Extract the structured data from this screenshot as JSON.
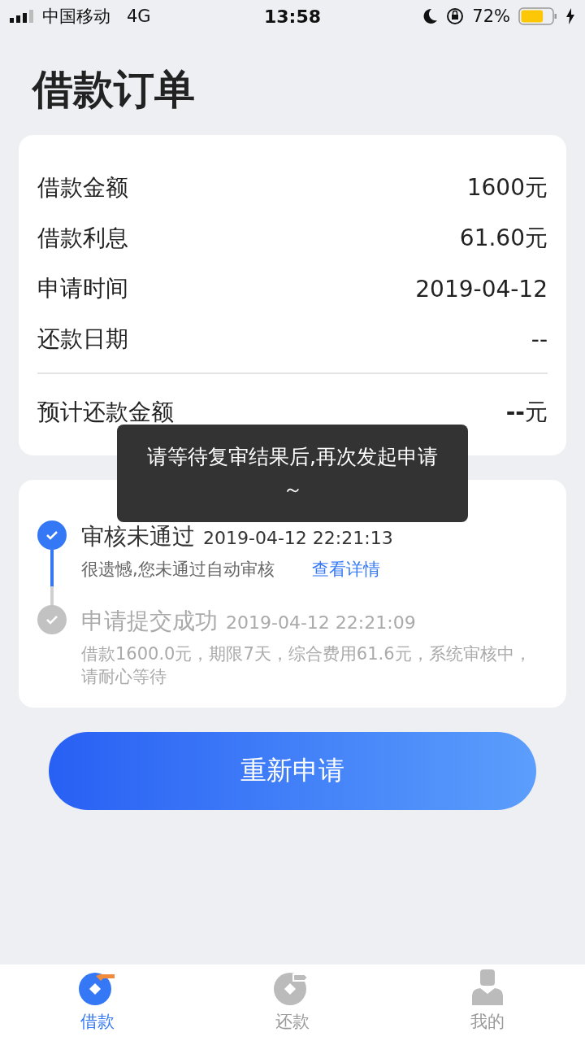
{
  "status_bar": {
    "carrier": "中国移动",
    "network": "4G",
    "time": "13:58",
    "battery": "72%",
    "level": 0.72
  },
  "title": "借款订单",
  "summary": {
    "rows": [
      {
        "label": "借款金额",
        "value": "1600元"
      },
      {
        "label": "借款利息",
        "value": "61.60元"
      },
      {
        "label": "申请时间",
        "value": "2019-04-12"
      },
      {
        "label": "还款日期",
        "value": "--"
      }
    ],
    "total": {
      "label": "预计还款金额",
      "value": "**--**元"
    }
  },
  "timeline": [
    {
      "title": "审核未通过",
      "time": "2019-04-12 22:21:13",
      "color": "#3478f6",
      "active": true,
      "description": "很遗憾,您未通过自动审核",
      "link": "查看详情"
    },
    {
      "title": "申请提交成功",
      "time": "2019-04-12 22:21:09",
      "color": "#c2c2c2",
      "active": false,
      "description": "借款1600.0元，期限7天，综合费用61.6元，系统审核中，请耐心等待"
    }
  ],
  "button": "重新申请",
  "toast": "请等待复审结果后,再次发起申请～",
  "tabs": [
    {
      "label": "借款",
      "kind": "borrow",
      "selected": true
    },
    {
      "label": "还款",
      "kind": "repay",
      "selected": false
    },
    {
      "label": "我的",
      "kind": "profile",
      "selected": false
    }
  ]
}
